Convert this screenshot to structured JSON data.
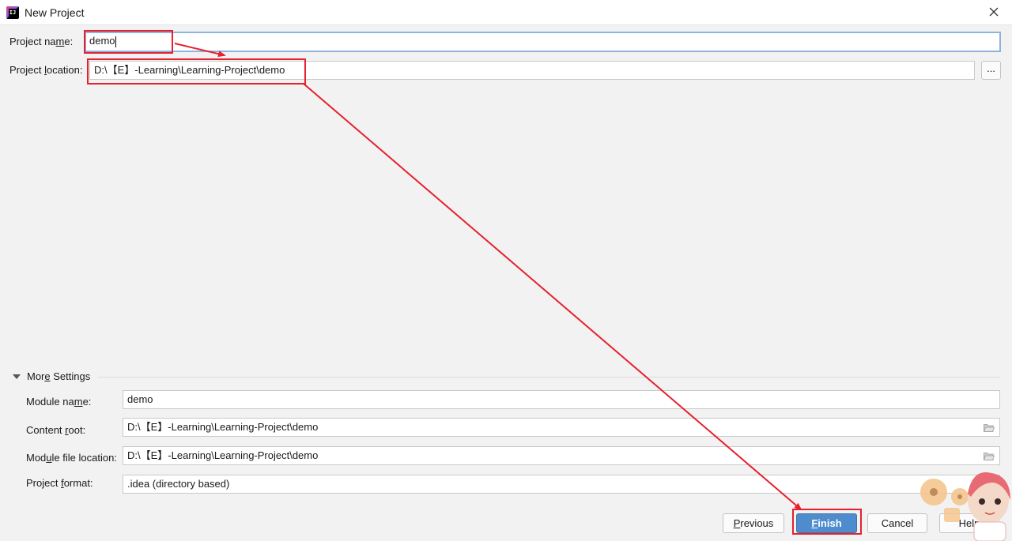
{
  "window": {
    "title": "New Project",
    "icon": "intellij-idea-icon"
  },
  "project": {
    "name_label_before": "Project na",
    "name_label_mnemonic": "m",
    "name_label_after": "e:",
    "name_value": "demo",
    "location_label_before": "Project ",
    "location_label_mnemonic": "l",
    "location_label_after": "ocation:",
    "location_value": "D:\\【E】-Learning\\Learning-Project\\demo",
    "browse_label": "..."
  },
  "more_settings": {
    "label_before": "Mor",
    "label_mnemonic": "e",
    "label_after": " Settings",
    "module_name_label_before": "Module na",
    "module_name_label_mnemonic": "m",
    "module_name_label_after": "e:",
    "module_name_value": "demo",
    "content_root_label_before": "Content ",
    "content_root_label_mnemonic": "r",
    "content_root_label_after": "oot:",
    "content_root_value": "D:\\【E】-Learning\\Learning-Project\\demo",
    "module_file_label_before": "Mod",
    "module_file_label_mnemonic": "u",
    "module_file_label_after": "le file location:",
    "module_file_value": "D:\\【E】-Learning\\Learning-Project\\demo",
    "format_label_before": "Project ",
    "format_label_mnemonic": "f",
    "format_label_after": "ormat:",
    "format_value": ".idea (directory based)"
  },
  "buttons": {
    "previous_mnemonic": "P",
    "previous_rest": "revious",
    "finish_mnemonic": "F",
    "finish_rest": "inish",
    "cancel": "Cancel",
    "help": "Help"
  },
  "colors": {
    "annotation_red": "#e5212f",
    "primary_button": "#4f8ccd",
    "focus_border": "#8fb3dc"
  }
}
